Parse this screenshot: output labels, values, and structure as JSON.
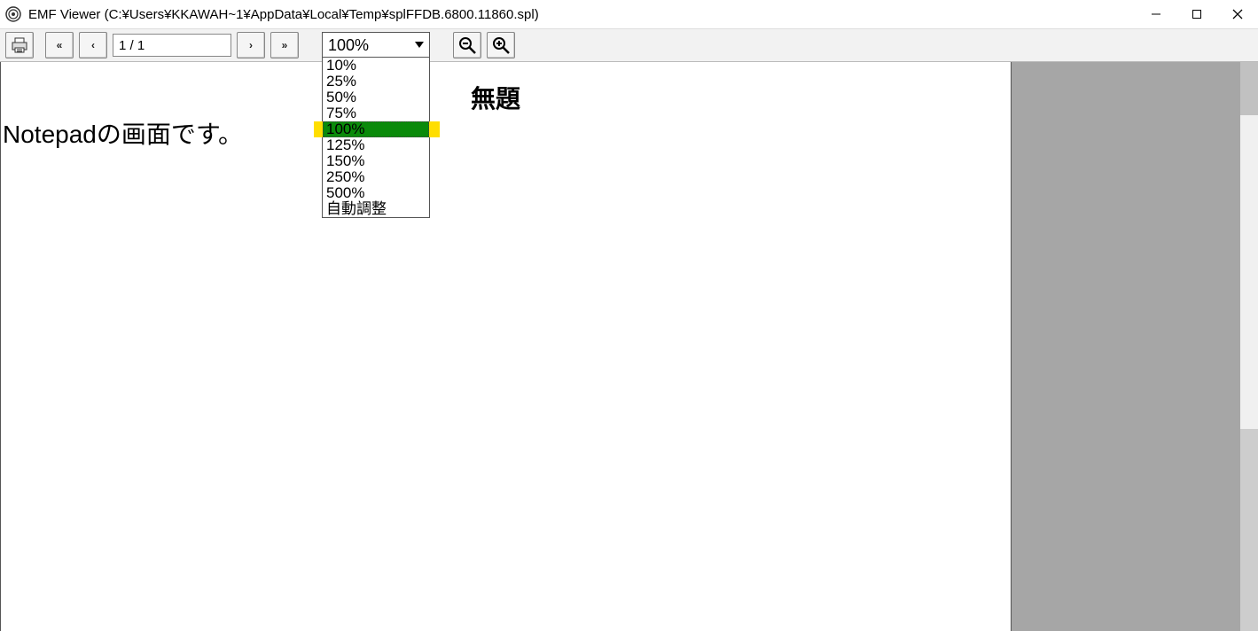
{
  "titlebar": {
    "title": "EMF Viewer (C:¥Users¥KKAWAH~1¥AppData¥Local¥Temp¥splFFDB.6800.11860.spl)"
  },
  "toolbar": {
    "first_label": "«",
    "prev_label": "‹",
    "page_value": "1 / 1",
    "next_label": "›",
    "last_label": "»",
    "zoom_value": "100%",
    "zoom_options": [
      "10%",
      "25%",
      "50%",
      "75%",
      "100%",
      "125%",
      "150%",
      "250%",
      "500%",
      "自動調整"
    ],
    "zoom_selected": "100%"
  },
  "document": {
    "title": "無題",
    "body": "Notepadの画面です。"
  }
}
